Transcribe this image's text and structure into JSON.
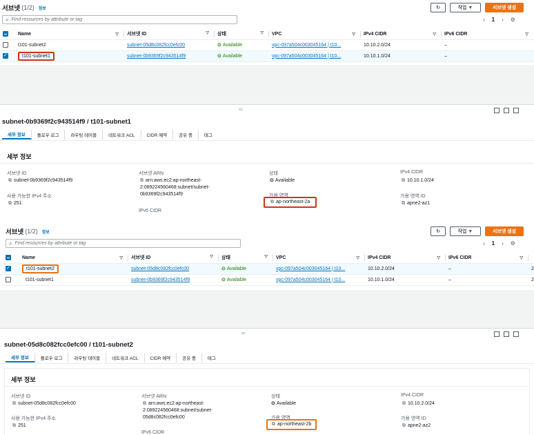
{
  "top": {
    "list_title": "서브넷",
    "list_count": "(1/2)",
    "info": "정보",
    "refresh_icon": "refresh-icon",
    "actions_label": "작업 ▼",
    "create_label": "서브넷 생성",
    "search_placeholder": "Find resources by attribute or tag",
    "page_num": "1",
    "columns": [
      "Name",
      "서브넷 ID",
      "상태",
      "VPC",
      "IPv4 CIDR",
      "IPv6 CIDR"
    ],
    "rows": [
      {
        "name": "t101-subnet2",
        "subnet_id": "subnet-05d8c082fcc0efc00",
        "status": "Available",
        "vpc": "vpc-097a504c003045164 | t10...",
        "ipv4": "10.10.2.0/24",
        "ipv6": "–"
      },
      {
        "name": "t101-subnet1",
        "subnet_id": "subnet-0b9369f2c943514f9",
        "status": "Available",
        "vpc": "vpc-097a504c003045164 | t10...",
        "ipv4": "10.10.1.0/24",
        "ipv6": "–"
      }
    ],
    "detail_title": "subnet-0b9369f2c943514f9 / t101-subnet1",
    "tabs": [
      "세부 정보",
      "플로우 로그",
      "라우팅 테이블",
      "네트워크 ACL",
      "CIDR 예약",
      "공유 중",
      "태그"
    ],
    "card_title": "세부 정보",
    "subnet_id_label": "서브넷 ID",
    "subnet_id_value": "subnet-0b9369f2c943514f9",
    "arn_label": "서브넷 ARN",
    "arn_value_1": "arn:aws:ec2:ap-northeast-",
    "arn_value_2": "2:089224560468:subnet/subnet-",
    "arn_value_3": "0b9369f2c943514f9",
    "state_label": "상태",
    "state_value": "Available",
    "ipv4_label": "IPv4 CIDR",
    "ipv4_value": "10.10.1.0/24",
    "avail_ipv4_label": "사용 가능한 IPv4 주소",
    "avail_ipv4_value": "251",
    "ipv6_label": "IPv6 CIDR",
    "az_label": "가용 영역",
    "az_value": "ap-northeast-2a",
    "azid_label": "가용 영역 ID",
    "azid_value": "apne2-az1"
  },
  "bottom": {
    "list_title": "서브넷",
    "list_count": "(1/2)",
    "info": "정보",
    "actions_label": "작업 ▼",
    "create_label": "서브넷 생성",
    "search_placeholder": "Find resources by attribute or tag",
    "page_num": "1",
    "columns": [
      "Name",
      "서브넷 ID",
      "상태",
      "VPC",
      "IPv4 CIDR",
      "IPv6 CIDR"
    ],
    "rows": [
      {
        "name": "t101-subnet2",
        "subnet_id": "subnet-05d8c082fcc0efc00",
        "status": "Available",
        "vpc": "vpc-097a504c003045164 | t10...",
        "ipv4": "10.10.2.0/24",
        "ipv6": "–",
        "extra": "2"
      },
      {
        "name": "t101-subnet1",
        "subnet_id": "subnet-0b9369f2c943514f9",
        "status": "Available",
        "vpc": "vpc-097a504c003045164 | t10...",
        "ipv4": "10.10.1.0/24",
        "ipv6": "–",
        "extra": "2"
      }
    ],
    "detail_title": "subnet-05d8c082fcc0efc00 / t101-subnet2",
    "tabs": [
      "세부 정보",
      "플로우 로그",
      "라우팅 테이블",
      "네트워크 ACL",
      "CIDR 예약",
      "공유 중",
      "태그"
    ],
    "card_title": "세부 정보",
    "subnet_id_label": "서브넷 ID",
    "subnet_id_value": "subnet-05d8c082fcc0efc00",
    "arn_label": "서브넷 ARN",
    "arn_value_1": "arn:aws:ec2:ap-northeast-",
    "arn_value_2": "2:089224560468:subnet/subnet-",
    "arn_value_3": "05d8c082fcc0efc00",
    "state_label": "상태",
    "state_value": "Available",
    "ipv4_label": "IPv4 CIDR",
    "ipv4_value": "10.10.2.0/24",
    "avail_ipv4_label": "사용 가능한 IPv4 주소",
    "avail_ipv4_value": "251",
    "ipv6_label": "IPv6 CIDR",
    "az_label": "가용 영역",
    "az_value": "ap-northeast-2b",
    "azid_label": "가용 영역 ID",
    "azid_value": "apne2-az2"
  }
}
